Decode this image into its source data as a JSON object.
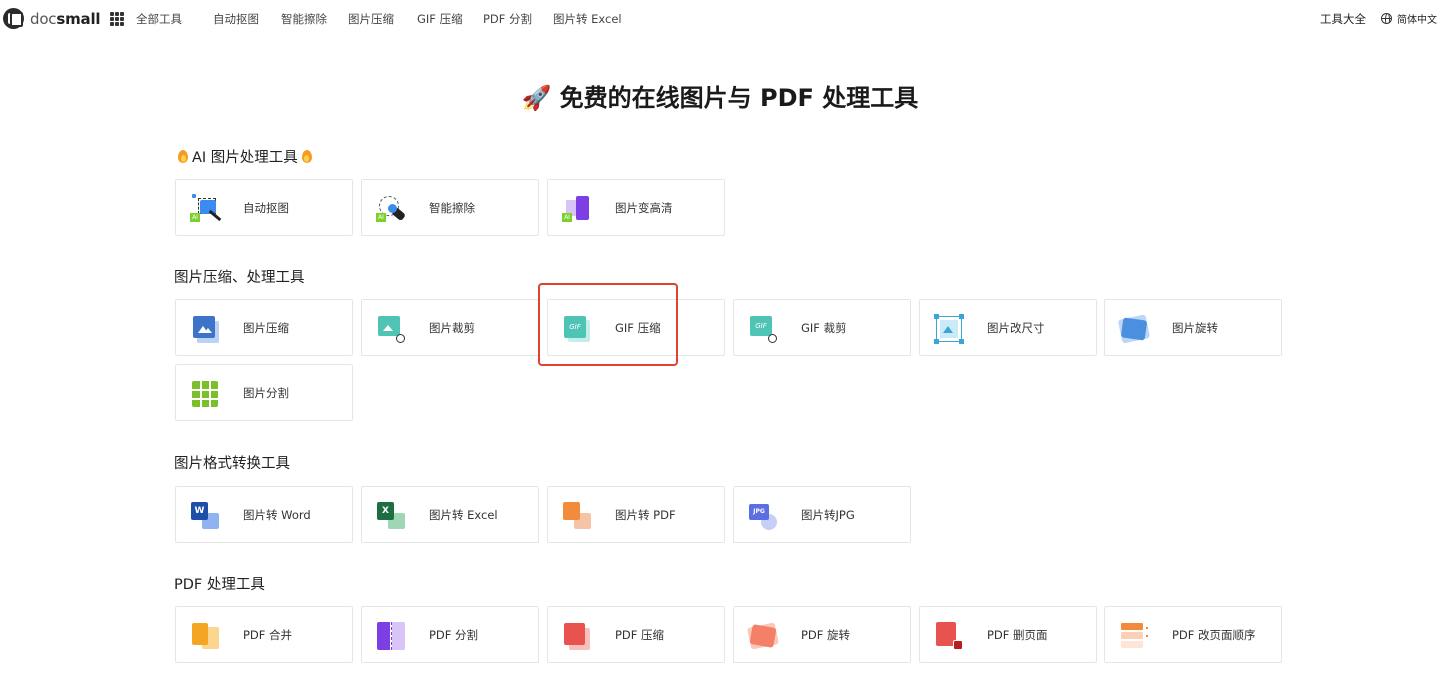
{
  "header": {
    "logo_doc": "doc",
    "logo_small": "small",
    "nav": [
      "全部工具",
      "自动抠图",
      "智能擦除",
      "图片压缩",
      "GIF 压缩",
      "PDF 分割",
      "图片转 Excel"
    ],
    "tools_all": "工具大全",
    "language": "简体中文"
  },
  "page_title": "免费的在线图片与 PDF 处理工具",
  "sections": {
    "ai": {
      "title": "AI 图片处理工具",
      "items": [
        "自动抠图",
        "智能擦除",
        "图片变高清"
      ]
    },
    "compress": {
      "title": "图片压缩、处理工具",
      "items": [
        "图片压缩",
        "图片裁剪",
        "GIF 压缩",
        "GIF 裁剪",
        "图片改尺寸",
        "图片旋转",
        "图片分割"
      ]
    },
    "convert": {
      "title": "图片格式转换工具",
      "items": [
        "图片转 Word",
        "图片转 Excel",
        "图片转 PDF",
        "图片转JPG"
      ]
    },
    "pdf": {
      "title": "PDF 处理工具",
      "items": [
        "PDF 合并",
        "PDF 分割",
        "PDF 压缩",
        "PDF 旋转",
        "PDF 删页面",
        "PDF 改页面顺序"
      ]
    }
  },
  "icon_badges": {
    "ai": "AI",
    "gif": "GIF",
    "word": "W",
    "excel": "X",
    "jpg": "JPG"
  },
  "colors": {
    "highlight": "#e1412e",
    "blue": "#3d73c9",
    "teal": "#4fc3b4",
    "purple": "#7b3fe4",
    "orange": "#f28b3c",
    "red": "#e8534f",
    "green": "#7cbf2c"
  }
}
